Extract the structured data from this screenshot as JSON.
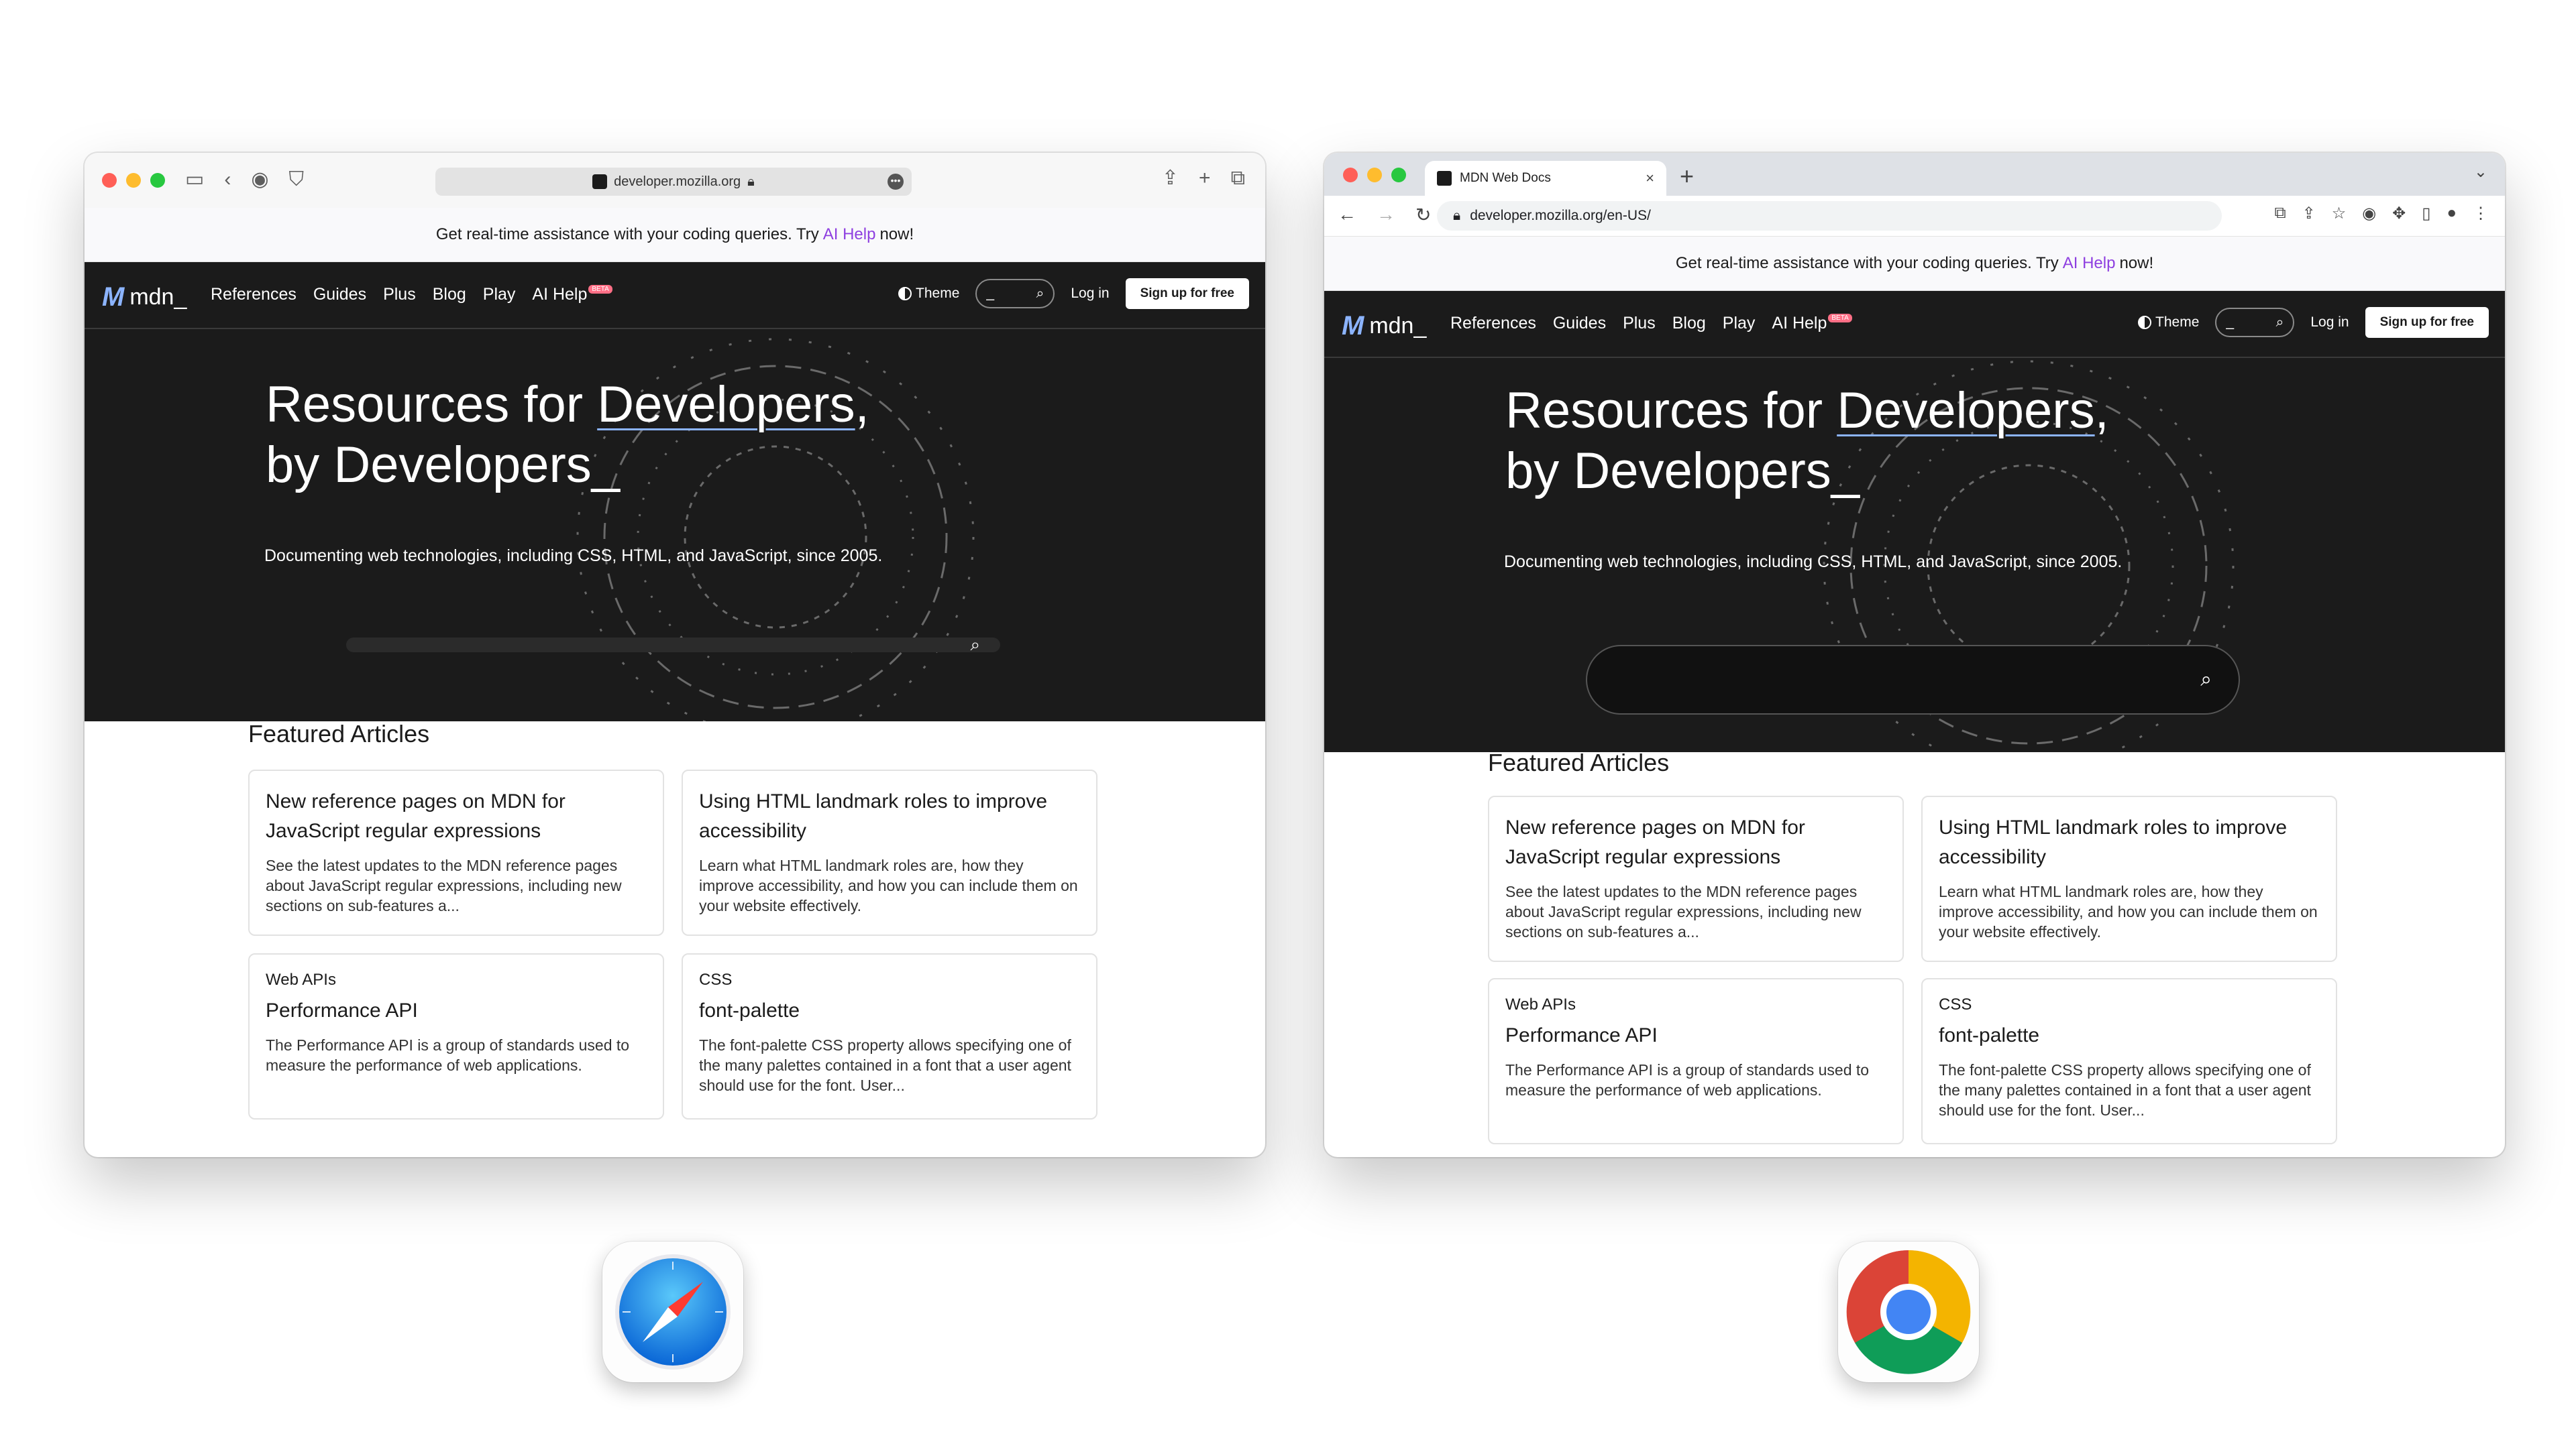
{
  "browsers": {
    "safari": {
      "url": "developer.mozilla.org"
    },
    "chrome": {
      "tab_title": "MDN Web Docs",
      "url": "developer.mozilla.org/en-US/"
    }
  },
  "page": {
    "banner": {
      "before": "Get real-time assistance with your coding queries. Try",
      "link": "AI Help",
      "after": "now!"
    },
    "logo": "mdn_",
    "nav": [
      "References",
      "Guides",
      "Plus",
      "Blog",
      "Play",
      "AI Help"
    ],
    "nav_badge": "BETA",
    "theme_label": "Theme",
    "search_placeholder": "_",
    "login_label": "Log in",
    "signup_label": "Sign up for free",
    "hero": {
      "line1_before": "Resources for ",
      "line1_link": "Developers",
      "line1_after": ",",
      "line2": "by Developers_",
      "subtitle": "Documenting web technologies, including CSS, HTML, and JavaScript, since 2005."
    },
    "featured_heading": "Featured Articles",
    "cards": [
      {
        "kicker": "",
        "title": "New reference pages on MDN for JavaScript regular expressions",
        "desc": "See the latest updates to the MDN reference pages about JavaScript regular expressions, including new sections on sub-features a..."
      },
      {
        "kicker": "",
        "title": "Using HTML landmark roles to improve accessibility",
        "desc": "Learn what HTML landmark roles are, how they improve accessibility, and how you can include them on your website effectively."
      },
      {
        "kicker": "Web APIs",
        "title": "Performance API",
        "desc": "The Performance API is a group of standards used to measure the performance of web applications."
      },
      {
        "kicker": "CSS",
        "title": "font-palette",
        "desc": "The font-palette CSS property allows specifying one of the many palettes contained in a font that a user agent should use for the font. User..."
      }
    ]
  },
  "colors": {
    "accent_link": "#8e3fe0",
    "mdn_dark": "#1b1b1b",
    "logo_blue": "#8cb4ff"
  }
}
